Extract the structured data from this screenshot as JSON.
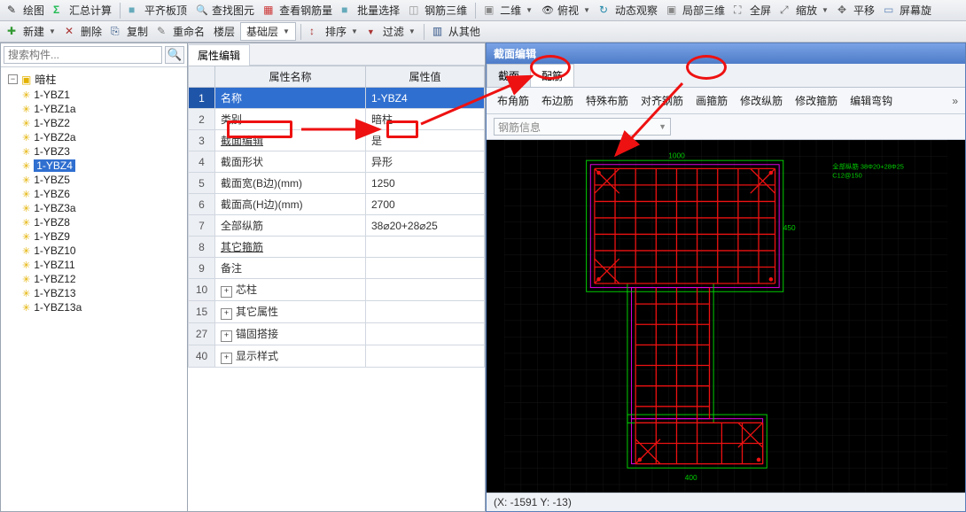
{
  "toolbar_top": {
    "draw": "绘图",
    "sumcalc": "汇总计算",
    "flatcheck": "平齐板顶",
    "findelm": "查找图元",
    "viewbar": "查看钢筋量",
    "batchsel": "批量选择",
    "bar3d": "钢筋三维",
    "view2d": "二维",
    "top": "俯视",
    "dynview": "动态观察",
    "local3d": "局部三维",
    "fullscreen": "全屏",
    "scale": "缩放",
    "pan": "平移",
    "screenrot": "屏幕旋"
  },
  "toolbar_edit": {
    "new": "新建",
    "del": "删除",
    "copy": "复制",
    "rename": "重命名",
    "floor": "楼层",
    "floor_val": "基础层",
    "sort": "排序",
    "filter": "过滤",
    "fromother": "从其他"
  },
  "search": {
    "placeholder": "搜索构件..."
  },
  "tree": {
    "root": "暗柱",
    "items": [
      {
        "label": "1-YBZ1"
      },
      {
        "label": "1-YBZ1a"
      },
      {
        "label": "1-YBZ2"
      },
      {
        "label": "1-YBZ2a"
      },
      {
        "label": "1-YBZ3"
      },
      {
        "label": "1-YBZ4",
        "selected": true
      },
      {
        "label": "1-YBZ5"
      },
      {
        "label": "1-YBZ6"
      },
      {
        "label": "1-YBZ3a"
      },
      {
        "label": "1-YBZ8"
      },
      {
        "label": "1-YBZ9"
      },
      {
        "label": "1-YBZ10"
      },
      {
        "label": "1-YBZ11"
      },
      {
        "label": "1-YBZ12"
      },
      {
        "label": "1-YBZ13"
      },
      {
        "label": "1-YBZ13a"
      }
    ]
  },
  "prop": {
    "editor_tab": "属性编辑",
    "header_name": "属性名称",
    "header_value": "属性值",
    "rows": [
      {
        "idx": "1",
        "name": "名称",
        "value": "1-YBZ4",
        "sel": true
      },
      {
        "idx": "2",
        "name": "类别",
        "value": "暗柱"
      },
      {
        "idx": "3",
        "name": "截面编辑",
        "value": "是",
        "link": true
      },
      {
        "idx": "4",
        "name": "截面形状",
        "value": "异形"
      },
      {
        "idx": "5",
        "name": "截面宽(B边)(mm)",
        "value": "1250"
      },
      {
        "idx": "6",
        "name": "截面高(H边)(mm)",
        "value": "2700"
      },
      {
        "idx": "7",
        "name": "全部纵筋",
        "value": "38⌀20+28⌀25"
      },
      {
        "idx": "8",
        "name": "其它箍筋",
        "value": "",
        "link": true
      },
      {
        "idx": "9",
        "name": "备注",
        "value": ""
      },
      {
        "idx": "10",
        "name": "芯柱",
        "value": "",
        "exp": true
      },
      {
        "idx": "15",
        "name": "其它属性",
        "value": "",
        "exp": true
      },
      {
        "idx": "27",
        "name": "锚固搭接",
        "value": "",
        "exp": true
      },
      {
        "idx": "40",
        "name": "显示样式",
        "value": "",
        "exp": true
      }
    ]
  },
  "section": {
    "title": "截面编辑",
    "tab_section": "截面",
    "tab_rebar": "配筋",
    "subtabs": {
      "corner": "布角筋",
      "edge": "布边筋",
      "special": "特殊布筋",
      "align": "对齐钢筋",
      "drawhoop": "画箍筋",
      "modvert": "修改纵筋",
      "modhoop": "修改箍筋",
      "edithook": "编辑弯钩"
    },
    "combo_label": "钢筋信息",
    "status": "(X: -1591 Y: -13)"
  },
  "canvas": {
    "label_top": "1000",
    "label_side": "450",
    "label_bottom": "400",
    "note": "全部纵筋 38Φ20+28Φ25 C12@150"
  }
}
